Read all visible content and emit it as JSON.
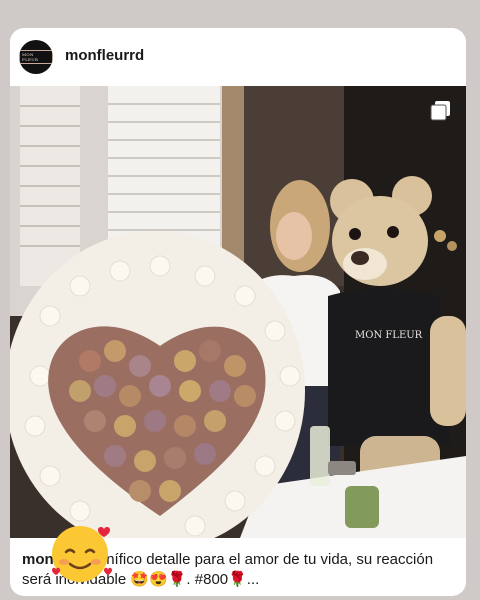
{
  "post": {
    "username": "monfleurrd",
    "avatar_text": "MON FLEUR",
    "caption_user": "mon",
    "caption_text": "Un Magnífico detalle para el amor de tu vida, su reacción será inolvidable 🤩😍🌹. #800🌹...",
    "sticker": "🥰"
  },
  "photo": {
    "bear_shirt_text": "MON FLEUR"
  },
  "icons": [
    "multi-photo-icon",
    "smiling-face-with-hearts-sticker"
  ]
}
